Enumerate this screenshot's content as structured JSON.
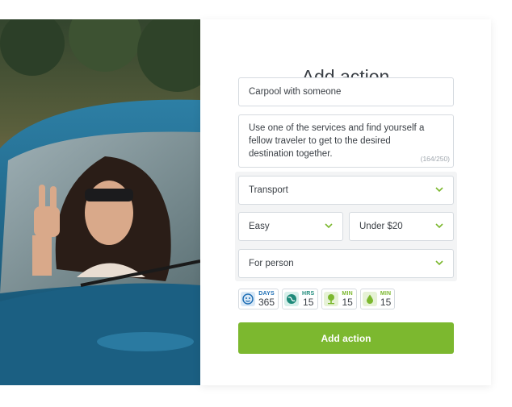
{
  "form": {
    "title": "Add action",
    "name_value": "Carpool with someone",
    "description_value": "Use one of the services and find yourself a fellow traveler to get to the desired destination together.",
    "description_counter": "(164/250)",
    "category_value": "Transport",
    "difficulty_value": "Easy",
    "cost_value": "Under $20",
    "audience_value": "For person",
    "submit_label": "Add action"
  },
  "stats": [
    {
      "label": "DAYS",
      "value": "365",
      "icon": "face-icon",
      "color": "#1f6fb5"
    },
    {
      "label": "HRS",
      "value": "15",
      "icon": "globe-icon",
      "color": "#1e8a7a"
    },
    {
      "label": "MIN",
      "value": "15",
      "icon": "tree-icon",
      "color": "#7cb82f"
    },
    {
      "label": "MIN",
      "value": "15",
      "icon": "drop-icon",
      "color": "#7cb82f"
    }
  ],
  "colors": {
    "accent": "#7cb82f",
    "text": "#3a3f45",
    "border": "#d6dbe0"
  }
}
